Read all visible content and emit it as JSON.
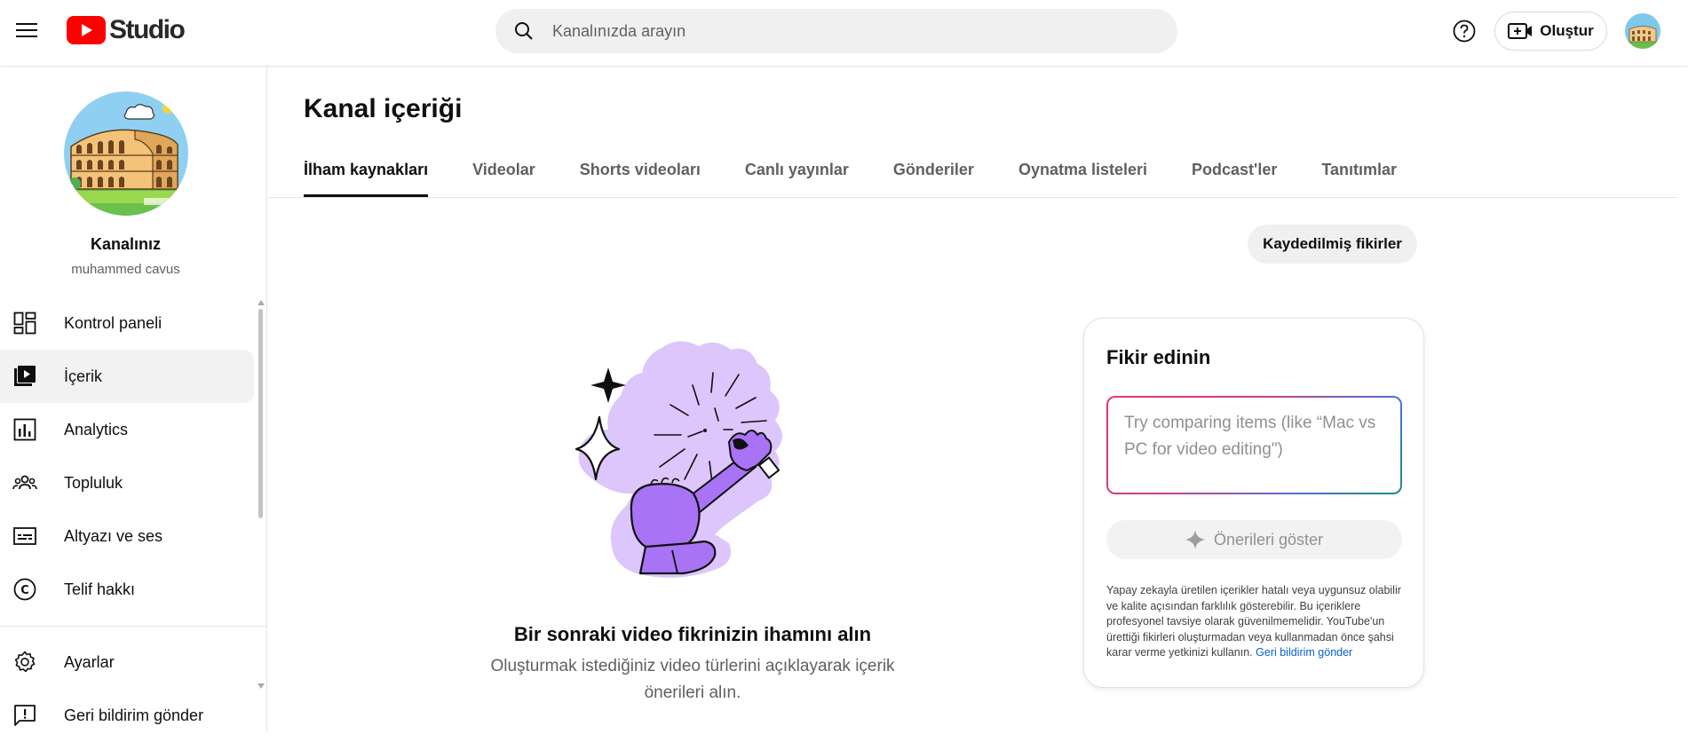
{
  "header": {
    "logo_text": "Studio",
    "search_placeholder": "Kanalınızda arayın",
    "create_label": "Oluştur"
  },
  "sidebar": {
    "channel_name": "Kanalınız",
    "channel_handle": "muhammed cavus",
    "items": [
      {
        "label": "Kontrol paneli",
        "icon": "dashboard-icon"
      },
      {
        "label": "İçerik",
        "icon": "content-icon",
        "active": true
      },
      {
        "label": "Analytics",
        "icon": "analytics-icon"
      },
      {
        "label": "Topluluk",
        "icon": "community-icon"
      },
      {
        "label": "Altyazı ve ses",
        "icon": "subtitles-icon"
      },
      {
        "label": "Telif hakkı",
        "icon": "copyright-icon"
      }
    ],
    "bottom_items": [
      {
        "label": "Ayarlar",
        "icon": "gear-icon"
      },
      {
        "label": "Geri bildirim gönder",
        "icon": "feedback-icon"
      }
    ]
  },
  "main": {
    "title": "Kanal içeriği",
    "tabs": [
      {
        "label": "İlham kaynakları",
        "active": true
      },
      {
        "label": "Videolar"
      },
      {
        "label": "Shorts videoları"
      },
      {
        "label": "Canlı yayınlar"
      },
      {
        "label": "Gönderiler"
      },
      {
        "label": "Oynatma listeleri"
      },
      {
        "label": "Podcast'ler"
      },
      {
        "label": "Tanıtımlar"
      }
    ],
    "saved_ideas_label": "Kaydedilmiş fikirler",
    "promo_title": "Bir sonraki video fikrinizin ihamını alın",
    "promo_subtitle": "Oluşturmak istediğiniz video türlerini açıklayarak içerik önerileri alın."
  },
  "idea_card": {
    "title": "Fikir edinin",
    "input_placeholder": "Try comparing items (like “Mac vs PC for video editing\")",
    "suggest_label": "Önerileri göster",
    "disclaimer": "Yapay zekayla üretilen içerikler hatalı veya uygunsuz olabilir ve kalite açısından farklılık gösterebilir. Bu içeriklere profesyonel tavsiye olarak güvenilmemelidir. YouTube'un ürettiği fikirleri oluşturmadan veya kullanmadan önce şahsi karar verme yetkinizi kullanın.",
    "feedback_link": "Geri bildirim gönder"
  },
  "colors": {
    "youtube_red": "#ff0000",
    "text_primary": "#0f0f0f",
    "text_secondary": "#606060",
    "link": "#065fd4",
    "illustration_purple": "#a873f5",
    "illustration_lilac": "#dcc6fb"
  }
}
